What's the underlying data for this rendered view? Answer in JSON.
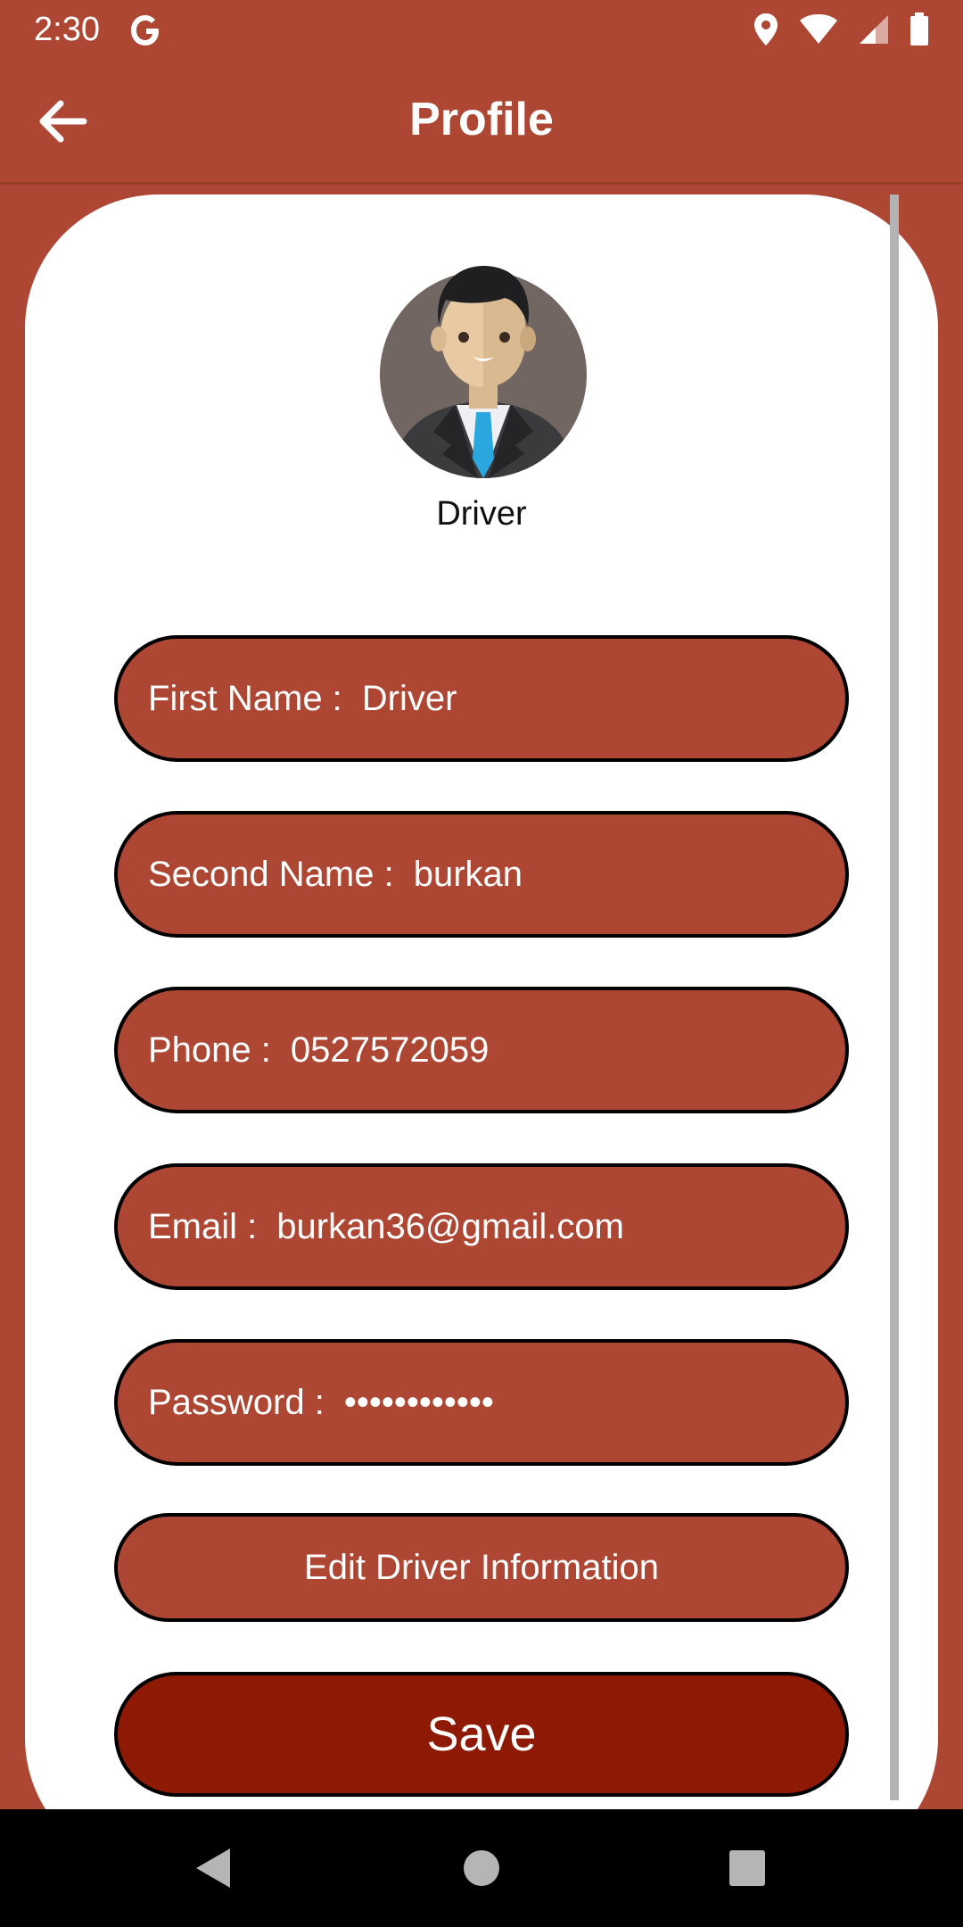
{
  "status_bar": {
    "time": "2:30",
    "icons": [
      "google-g-icon",
      "location-icon",
      "wifi-icon",
      "signal-icon",
      "battery-icon"
    ]
  },
  "app_bar": {
    "title": "Profile",
    "back_icon": "arrow-left-icon"
  },
  "profile": {
    "avatar_icon": "businessman-avatar-icon",
    "role": "Driver"
  },
  "fields": [
    {
      "label": "First Name :",
      "value": "Driver"
    },
    {
      "label": "Second Name :",
      "value": "burkan"
    },
    {
      "label": "Phone :",
      "value": "0527572059"
    },
    {
      "label": "Email :",
      "value": "burkan36@gmail.com"
    },
    {
      "label": "Password :",
      "value": "••••••••••••"
    }
  ],
  "buttons": {
    "edit": "Edit Driver Information",
    "save": "Save"
  },
  "nav_bar": {
    "icons": [
      "back-triangle-icon",
      "home-circle-icon",
      "recents-square-icon"
    ]
  },
  "colors": {
    "primary": "#ad4632",
    "save_button": "#8e1a06",
    "card": "#ffffff",
    "nav_bar": "#000000"
  }
}
